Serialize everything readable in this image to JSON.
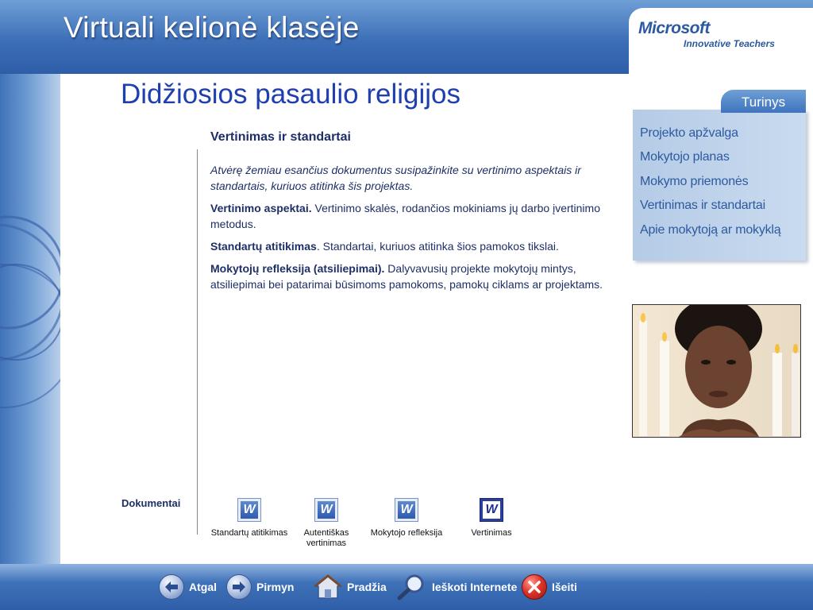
{
  "header": {
    "title": "Virtuali kelionė klasėje",
    "brand_microsoft": "Microsoft",
    "brand_tagline": "Innovative Teachers"
  },
  "page": {
    "title": "Didžiosios pasaulio religijos",
    "section_heading": "Vertinimas ir standartai"
  },
  "content": {
    "intro": "Atvėrę žemiau esančius dokumentus susipažinkite su vertinimo aspektais ir standartais, kuriuos atitinka  šis projektas.",
    "p1_bold": "Vertinimo aspektai.",
    "p1_text": " Vertinimo skalės, rodančios mokiniams jų darbo įvertinimo metodus.",
    "p2_bold": "Standartų atitikimas",
    "p2_text": ".  Standartai, kuriuos atitinka šios pamokos tikslai.",
    "p3_bold": "Mokytojų refleksija (atsiliepimai).",
    "p3_text": " Dalyvavusių projekte mokytojų mintys, atsiliepimai bei patarimai būsimoms pamokoms, pamokų ciklams ar projektams."
  },
  "nav": {
    "tab_label": "Turinys",
    "items": [
      {
        "label": "Projekto apžvalga"
      },
      {
        "label": "Mokytojo planas"
      },
      {
        "label": "Mokymo priemonės"
      },
      {
        "label": "Vertinimas ir standartai"
      },
      {
        "label": "Apie mokytoją ar mokyklą"
      }
    ]
  },
  "documents": {
    "label": "Dokumentai",
    "items": [
      {
        "label": "Standartų atitikimas",
        "icon": "word-doc-icon"
      },
      {
        "label": "Autentiškas vertinimas",
        "icon": "word-doc-icon"
      },
      {
        "label": "Mokytojo refleksija",
        "icon": "word-doc-icon"
      },
      {
        "label": "Vertinimas",
        "icon": "word-doc-icon"
      }
    ]
  },
  "bottom_nav": {
    "back": "Atgal",
    "forward": "Pirmyn",
    "home": "Pradžia",
    "search": "Ieškoti Internete",
    "exit": "Išeiti"
  },
  "colors": {
    "title_blue": "#1f3fae",
    "nav_text": "#2c5aa0",
    "text_navy": "#1d2f66",
    "header_blue": "#3c6fb7"
  }
}
